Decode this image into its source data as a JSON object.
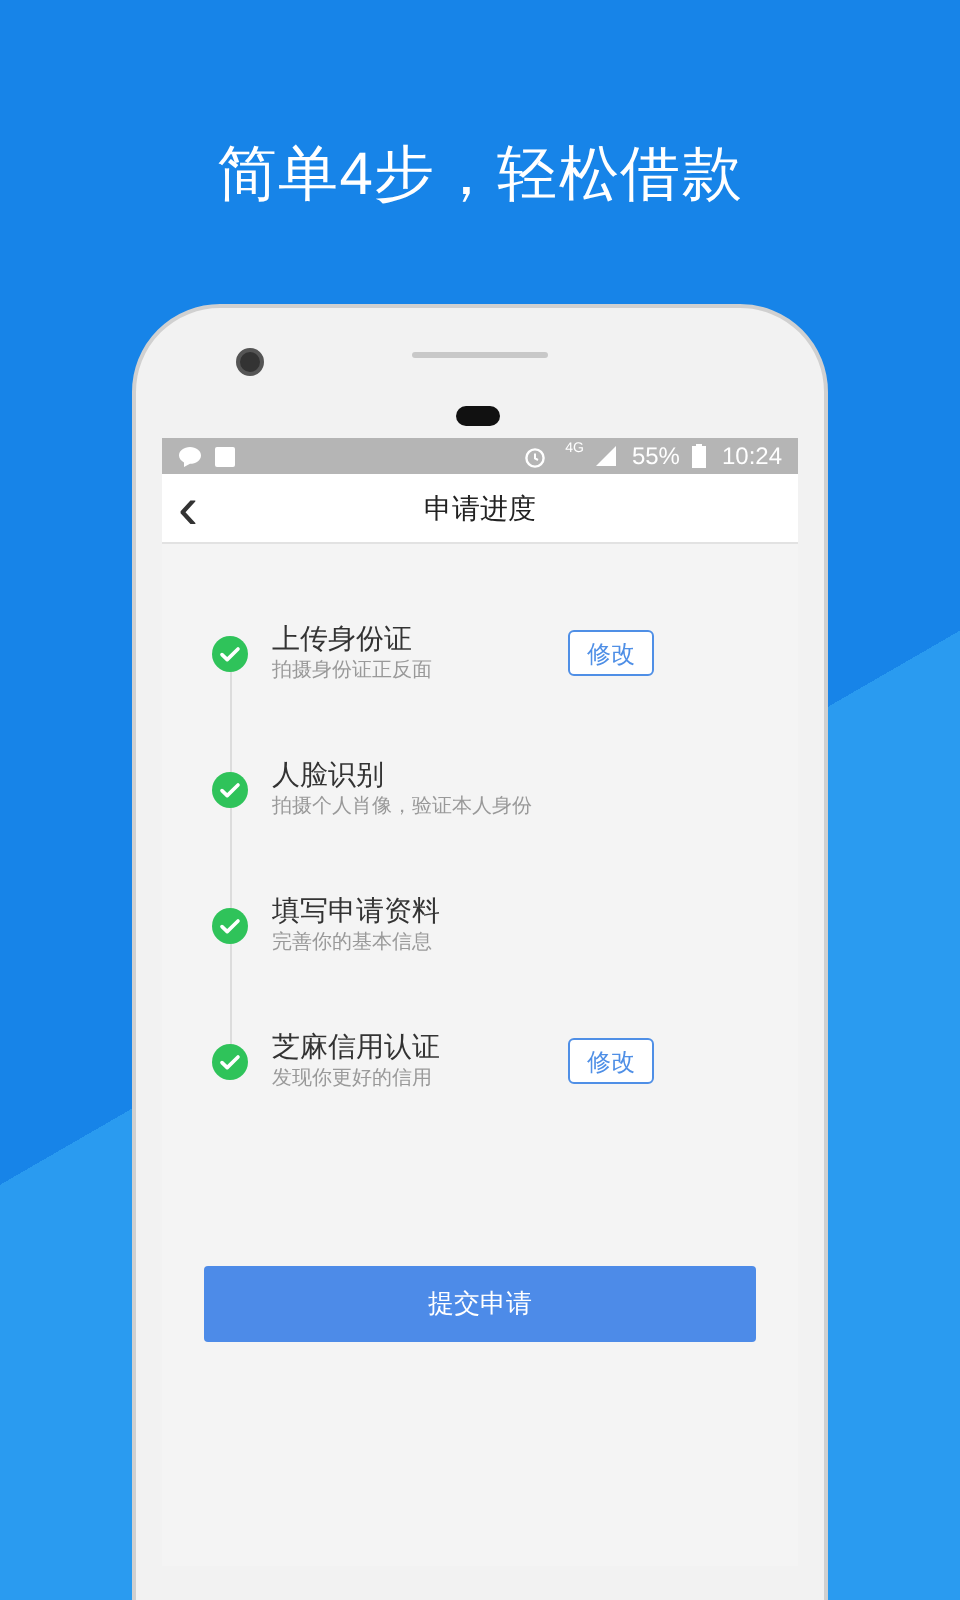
{
  "headline": "简单4步，轻松借款",
  "status_bar": {
    "network": "4G",
    "battery": "55%",
    "time": "10:24"
  },
  "header": {
    "back": "‹",
    "title": "申请进度"
  },
  "steps": [
    {
      "title": "上传身份证",
      "subtitle": "拍摄身份证正反面",
      "done": true,
      "action": "修改"
    },
    {
      "title": "人脸识别",
      "subtitle": "拍摄个人肖像，验证本人身份",
      "done": true
    },
    {
      "title": "填写申请资料",
      "subtitle": "完善你的基本信息",
      "done": true
    },
    {
      "title": "芝麻信用认证",
      "subtitle": "发现你更好的信用",
      "done": true,
      "action": "修改"
    }
  ],
  "submit": "提交申请"
}
